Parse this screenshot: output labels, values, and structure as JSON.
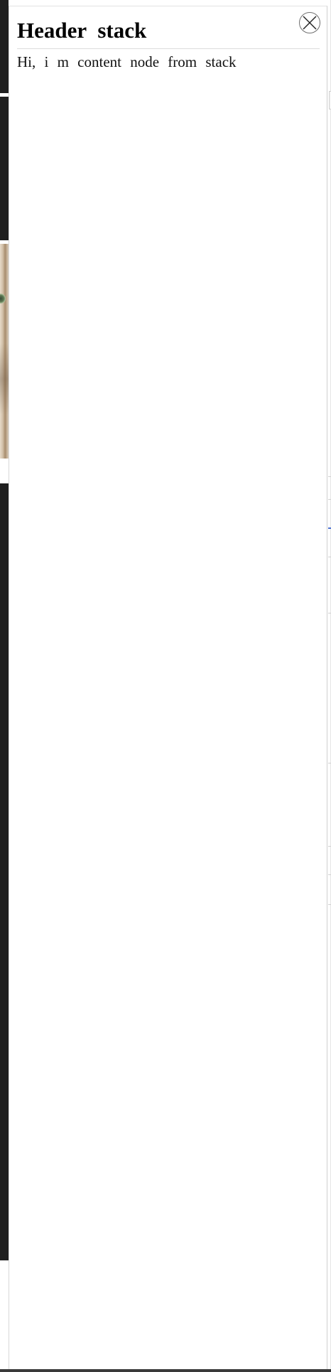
{
  "sheet": {
    "title": "Header  stack",
    "content_text": "Hi,  i  m  content  node  from  stack",
    "close_icon": "close-icon"
  },
  "colors": {
    "background": "#ffffff",
    "page_dark_strip": "#1f1f1f",
    "divider": "#dcdcdc",
    "title_text": "#000000",
    "close_border": "#6f6f6f"
  }
}
